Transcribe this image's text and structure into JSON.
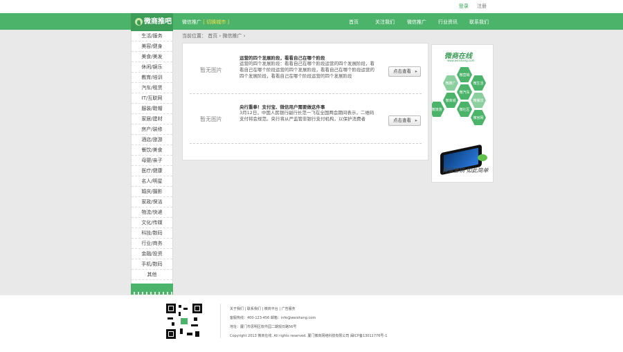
{
  "topbar": {
    "login": "登录",
    "register": "注册"
  },
  "logo": {
    "text": "微商推吧"
  },
  "subnav": {
    "label": "微信推广",
    "city": "[ 切换城市 ]"
  },
  "nav": [
    "首页",
    "关注我们",
    "微信推广",
    "行业资讯",
    "联系我们"
  ],
  "sidebar": {
    "items": [
      "生活/服务",
      "美容/健身",
      "美食/美发",
      "休闲/娱乐",
      "教育/培训",
      "汽车/租赁",
      "IT/互联网",
      "服装/鞋帽",
      "家居/建材",
      "房产/装修",
      "酒店/旅游",
      "餐饮/美食",
      "母婴/亲子",
      "医疗/健康",
      "名人/明星",
      "婚庆/摄影",
      "家政/保洁",
      "物流/快递",
      "文化/传媒",
      "科技/数码",
      "行业/商务",
      "金融/投资",
      "手机/数码",
      "其他"
    ]
  },
  "breadcrumb": {
    "prefix": "当前位置：",
    "home": "首页",
    "sep": "›",
    "current": "微信推广",
    "tail": "›"
  },
  "posts": [
    {
      "thumb": "暂无图片",
      "title": "运营的四个发展阶段，看看自己在哪个阶段",
      "desc": "运营的四个发展阶段：看看自己在哪个阶段运营的四个发展阶段，看看自己在哪个阶段运营的四个发展阶段，看看自己在哪个阶段运营的四个发展阶段，看看自己在哪个阶段运营的四个发展阶段",
      "button": "点击查看"
    },
    {
      "thumb": "暂无图片",
      "title": "央行重拳！支付宝、微信用户需要做这件事",
      "desc": "3月12日，中国人民银行副行长范一飞在全国两会期间表示，二维码支付将会规范。央行将从严监管非银行支付机构，以保护消费者",
      "button": "点击查看"
    }
  ],
  "ad": {
    "logo": "微商在线",
    "url": "www.weishang.com",
    "hexes": [
      "微营销",
      "微生活",
      "微推广",
      "微汽车",
      "微餐饮",
      "微商城",
      "微社区",
      "微旅游",
      "微官网"
    ],
    "slogan": "微信营销 如此简单"
  },
  "footer": {
    "links": "关于我们 | 联系我们 | 微商平台 | 广告服务",
    "contact": "客服热线：400-123-456  邮箱：info@weishang.com",
    "address": "地址：厦门市思明区软件园二期观日路56号",
    "copyright": "Copyright 2013 微商在线. All rights reserved.  厦门微商网络科技有限公司  闽ICP备13011776号-1"
  },
  "colors": {
    "brand_green": "#4cb36a",
    "dark_green": "#3c9c58",
    "background": "#e9e9e9"
  }
}
